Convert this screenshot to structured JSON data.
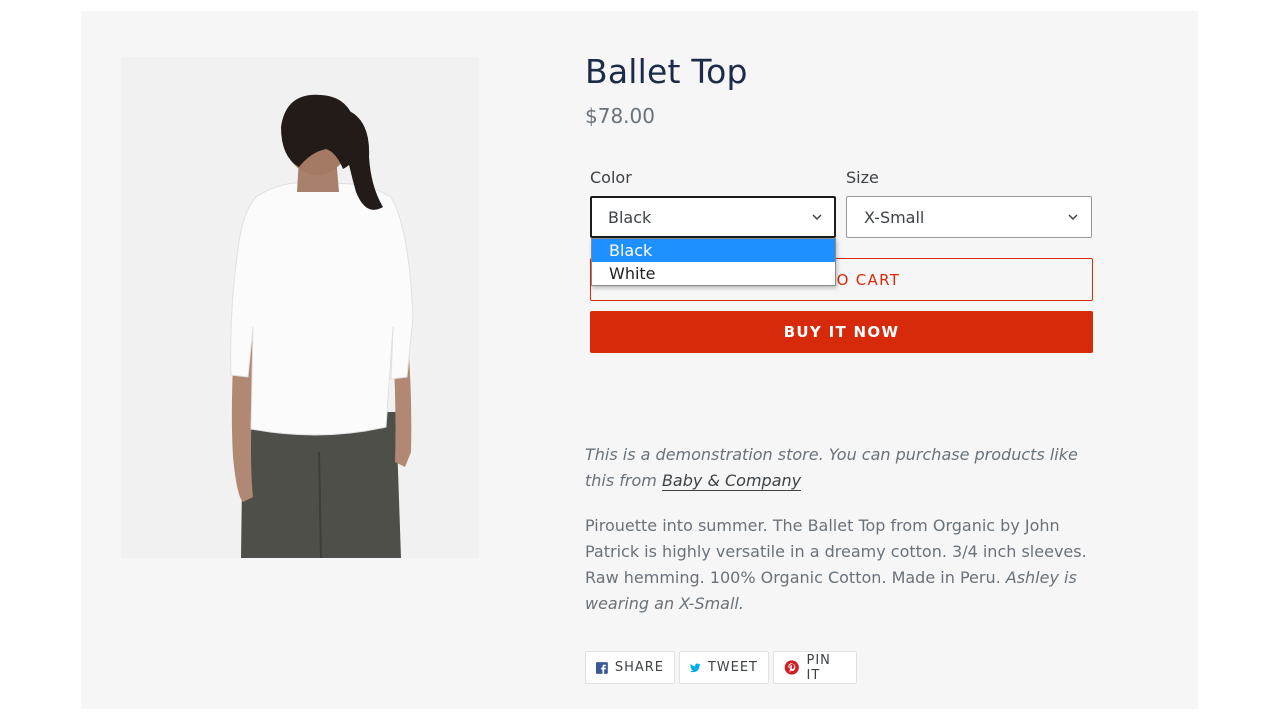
{
  "product": {
    "title": "Ballet Top",
    "price": "$78.00",
    "image_alt": "Model wearing white ballet top, viewed from behind"
  },
  "options": {
    "color": {
      "label": "Color",
      "selected": "Black",
      "dropdown_options": [
        "Black",
        "White"
      ],
      "highlighted": "Black"
    },
    "size": {
      "label": "Size",
      "selected": "X-Small"
    }
  },
  "buttons": {
    "add_to_cart": "ADD TO CART",
    "buy_now": "BUY IT NOW"
  },
  "description": {
    "notice_text": "This is a demonstration store. You can purchase products like this from ",
    "notice_link": "Baby & Company",
    "body_text": "Pirouette into summer. The Ballet Top from Organic by John Patrick is highly versatile in a dreamy cotton. 3/4 inch sleeves. Raw hemming. 100% Organic Cotton. Made in Peru. ",
    "body_italic": "Ashley is wearing an X-Small."
  },
  "share": {
    "facebook": "SHARE",
    "twitter": "TWEET",
    "pinterest": "PIN IT"
  },
  "colors": {
    "accent": "#d72a0b",
    "title": "#1c2b4a",
    "dropdown_highlight": "#1e90ff",
    "facebook": "#3b5998",
    "twitter": "#00aced",
    "pinterest": "#cb2027"
  },
  "icons": [
    "chevron-down-icon",
    "facebook-icon",
    "twitter-icon",
    "pinterest-icon"
  ]
}
